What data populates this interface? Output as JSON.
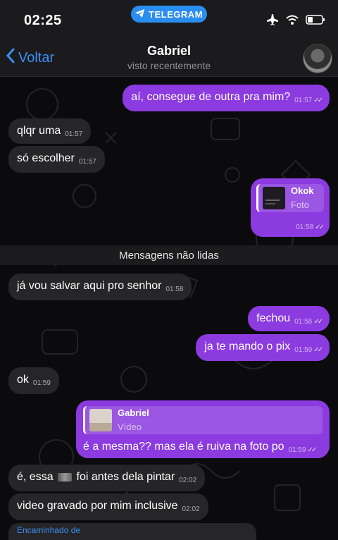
{
  "status_bar": {
    "time": "02:25",
    "app_pill": "TELEGRAM"
  },
  "header": {
    "back_label": "Voltar",
    "contact_name": "Gabriel",
    "status": "visto recentemente"
  },
  "unread_divider": "Mensagens não lidas",
  "messages": [
    {
      "dir": "out",
      "text": "aí, consegue de outra pra mim?",
      "time": "01:57"
    },
    {
      "dir": "in",
      "text": "qlqr uma",
      "time": "01:57"
    },
    {
      "dir": "in",
      "text": "só escolher",
      "time": "01:57"
    },
    {
      "dir": "out",
      "reply_name": "Okok",
      "reply_type": "Foto",
      "time": "01:58"
    },
    {
      "dir": "in",
      "text": "já vou salvar aqui pro senhor",
      "time": "01:58"
    },
    {
      "dir": "out",
      "text": "fechou",
      "time": "01:58"
    },
    {
      "dir": "out",
      "text": "ja te mando o pix",
      "time": "01:59"
    },
    {
      "dir": "in",
      "text": "ok",
      "time": "01:59"
    },
    {
      "dir": "out",
      "reply_name": "Gabriel",
      "reply_type": "Vídeo",
      "text": "é a mesma?? mas ela é ruiva na foto po",
      "time": "01:59"
    },
    {
      "dir": "in",
      "text_a": "é, essa",
      "text_b": "foi antes dela pintar",
      "time": "02:02"
    },
    {
      "dir": "in",
      "text": "video gravado por mim inclusive",
      "time": "02:02"
    }
  ],
  "forwarded_label": "Encaminhado de",
  "colors": {
    "outgoing": "#8b3bdf",
    "incoming": "#262628",
    "accent": "#3a8ff5",
    "pill": "#2a8df0"
  },
  "icons": [
    "telegram-logo-icon",
    "airplane-icon",
    "wifi-icon",
    "battery-icon",
    "chevron-left-icon",
    "read-checkmark-icon"
  ]
}
